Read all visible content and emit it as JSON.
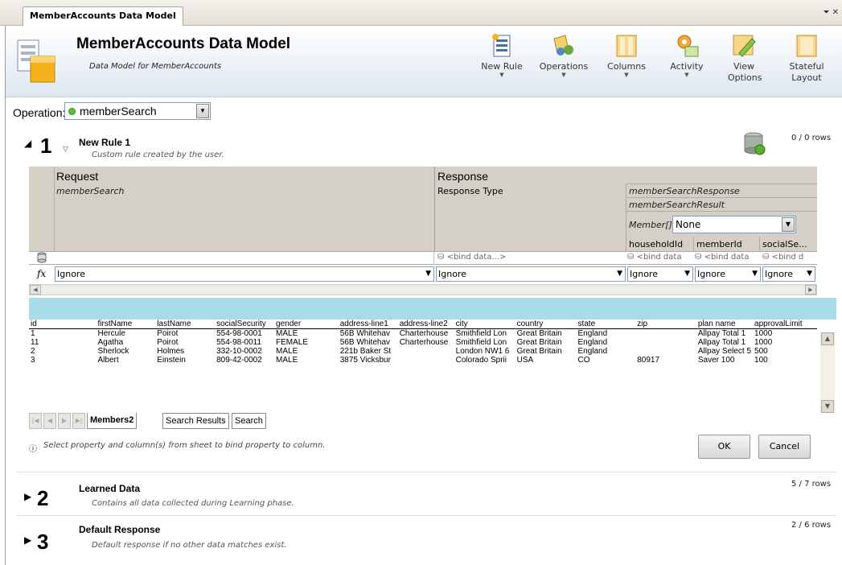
{
  "tab": {
    "label": "MemberAccounts Data Model",
    "menu_glyph": "⏷ ✕"
  },
  "header": {
    "title": "MemberAccounts Data Model",
    "subtitle": "Data Model for MemberAccounts",
    "buttons": [
      {
        "label": "New Rule",
        "icon": "new-rule-icon",
        "has_dropdown": true
      },
      {
        "label": "Operations",
        "icon": "operations-icon",
        "has_dropdown": true
      },
      {
        "label": "Columns",
        "icon": "columns-icon",
        "has_dropdown": true
      },
      {
        "label": "Activity",
        "icon": "activity-icon",
        "has_dropdown": true
      },
      {
        "label": "View Options",
        "icon": "view-options-icon",
        "has_dropdown": true
      },
      {
        "label": "Stateful Layout",
        "icon": "stateful-layout-icon",
        "has_dropdown": false
      }
    ]
  },
  "operation": {
    "label": "Operation:",
    "value": "memberSearch"
  },
  "rules": [
    {
      "num": "1",
      "title": "New Rule 1",
      "desc": "Custom rule created by the user.",
      "rows": "0 / 0 rows",
      "expanded": true
    },
    {
      "num": "2",
      "title": "Learned Data",
      "desc": "Contains all data collected during Learning phase.",
      "rows": "5 / 7 rows",
      "expanded": false
    },
    {
      "num": "3",
      "title": "Default Response",
      "desc": "Default response if no other data matches exist.",
      "rows": "2 / 6 rows",
      "expanded": false
    }
  ],
  "grid": {
    "request_label": "Request",
    "response_label": "Response",
    "request_op": "memberSearch",
    "response_type_label": "Response Type",
    "response_name": "memberSearchResponse",
    "result_name": "memberSearchResult",
    "member_label": "Member[]",
    "member_select": "None",
    "columns": [
      "householdId",
      "memberId",
      "socialSe..."
    ],
    "bind_placeholder": "<bind data...>",
    "bind_short": "<bind data",
    "bind_short2": "<bind d",
    "fx_values": [
      "Ignore",
      "Ignore",
      "Ignore",
      "Ignore",
      "Ignore"
    ]
  },
  "sheet": {
    "headers": [
      "id",
      "firstName",
      "lastName",
      "socialSecurity",
      "gender",
      "address-line1",
      "address-line2",
      "city",
      "country",
      "state",
      "zip",
      "plan name",
      "approvalLimit"
    ],
    "rows": [
      [
        "1",
        "Hercule",
        "Poirot",
        "554-98-0001",
        "MALE",
        "56B Whitehav",
        "Charterhouse",
        "Smithfield Lon",
        "Great Britain",
        "England",
        "",
        "Allpay Total 1",
        "1000"
      ],
      [
        "11",
        "Agatha",
        "Poirot",
        "554-98-0011",
        "FEMALE",
        "56B Whitehav",
        "Charterhouse",
        "Smithfield Lon",
        "Great Britain",
        "England",
        "",
        "Allpay Total 1",
        "1000"
      ],
      [
        "2",
        "Sherlock",
        "Holmes",
        "332-10-0002",
        "MALE",
        "221b Baker St",
        "",
        "London NW1 6",
        "Great Britain",
        "England",
        "",
        "Allpay Select 5",
        "500"
      ],
      [
        "3",
        "Albert",
        "Einstein",
        "809-42-0002",
        "MALE",
        "3875 Vicksbur",
        "",
        "Colorado Sprii",
        "USA",
        "CO",
        "80917",
        "Saver 100",
        "100"
      ]
    ],
    "tabs": [
      "Members2",
      "Search Results",
      "Search"
    ],
    "active_tab": "Members2"
  },
  "hint": "Select property and column(s) from sheet to bind property to column.",
  "ok_label": "OK",
  "cancel_label": "Cancel"
}
